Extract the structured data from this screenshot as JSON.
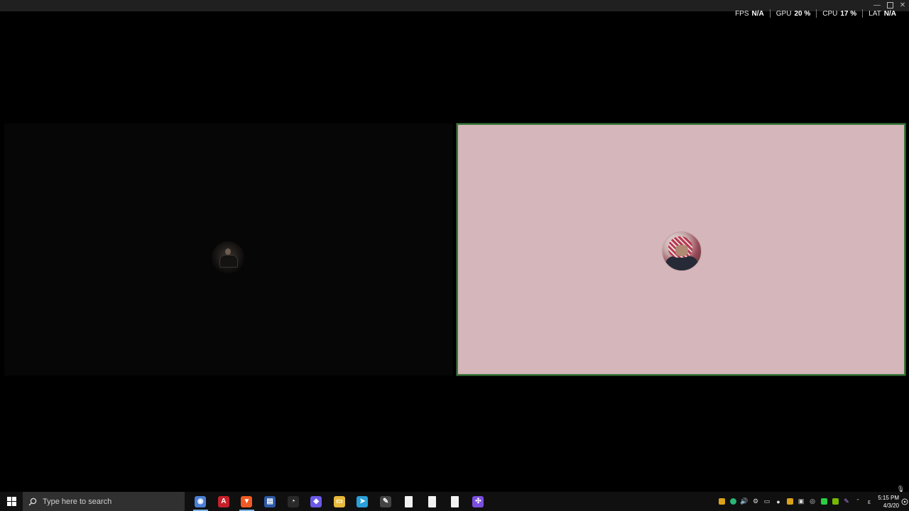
{
  "perf": {
    "fps_label": "FPS",
    "fps_value": "N/A",
    "gpu_label": "GPU",
    "gpu_value": "20 %",
    "cpu_label": "CPU",
    "cpu_value": "17 %",
    "lat_label": "LAT",
    "lat_value": "N/A"
  },
  "tiles": {
    "left": {
      "avatar_icon": "user-avatar-dark",
      "background": "#060606"
    },
    "right": {
      "avatar_icon": "user-avatar-keffiyeh",
      "background": "#d5b6ba",
      "active_border": "#3c7a3c"
    }
  },
  "taskbar": {
    "search_placeholder": "Type here to search",
    "apps": [
      {
        "name": "chrome-icon",
        "color": "#4a7fd4",
        "glyph": "◉",
        "active": true
      },
      {
        "name": "acrobat-icon",
        "color": "#c6202a",
        "glyph": "A",
        "active": false
      },
      {
        "name": "brave-icon",
        "color": "#f05a24",
        "glyph": "▼",
        "active": true
      },
      {
        "name": "outlook-icon",
        "color": "#2d5aa8",
        "glyph": "▤",
        "active": false
      },
      {
        "name": "speedtest-icon",
        "color": "#2a2a2a",
        "glyph": "◔",
        "active": false
      },
      {
        "name": "linear-icon",
        "color": "#6b59e8",
        "glyph": "◆",
        "active": false
      },
      {
        "name": "file-explorer-icon",
        "color": "#e8b93a",
        "glyph": "▭",
        "active": false
      },
      {
        "name": "telegram-icon",
        "color": "#2aa0d8",
        "glyph": "➤",
        "active": false
      },
      {
        "name": "tool-icon",
        "color": "#444444",
        "glyph": "✎",
        "active": false
      },
      {
        "name": "document-icon-1",
        "color": "#f2f2f2",
        "glyph": "",
        "active": false
      },
      {
        "name": "document-icon-2",
        "color": "#f2f2f2",
        "glyph": "",
        "active": false
      },
      {
        "name": "document-icon-3",
        "color": "#f2f2f2",
        "glyph": "",
        "active": false
      },
      {
        "name": "gamepad-icon",
        "color": "#7b4ee0",
        "glyph": "✣",
        "active": false
      }
    ],
    "clock_time": "5:15 PM",
    "clock_date": "4/3/20"
  }
}
